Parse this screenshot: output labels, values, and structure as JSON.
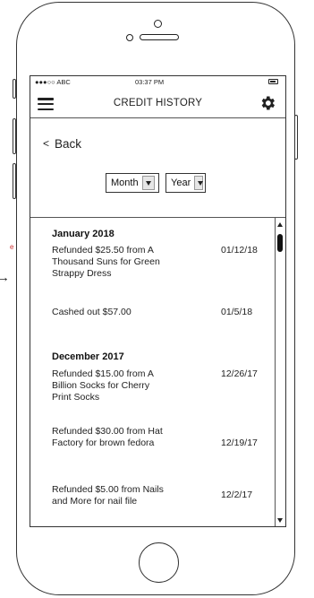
{
  "status_bar": {
    "carrier": "●●●○○ ABC",
    "time": "03:37 PM",
    "icon": "battery-icon"
  },
  "nav": {
    "title": "CREDIT HISTORY",
    "menu_icon": "hamburger-menu-icon",
    "settings_icon": "gear-icon"
  },
  "back": {
    "chevron": "<",
    "label": "Back"
  },
  "filters": {
    "month_label": "Month",
    "year_label": "Year"
  },
  "history": [
    {
      "month": "January 2018",
      "entries": [
        {
          "description": "Refunded $25.50 from A Thousand Suns for Green Strappy Dress",
          "date": "01/12/18"
        },
        {
          "description": "Cashed out $57.00",
          "date": "01/5/18"
        }
      ]
    },
    {
      "month": "December 2017",
      "entries": [
        {
          "description": "Refunded $15.00 from A Billion Socks for Cherry Print Socks",
          "date": "12/26/17"
        },
        {
          "description": "Refunded $30.00 from Hat Factory for brown fedora",
          "date": "12/19/17"
        },
        {
          "description": "Refunded $5.00 from Nails and More for nail file",
          "date": "12/2/17"
        }
      ]
    }
  ],
  "outside_marks": {
    "arrow": "→"
  }
}
